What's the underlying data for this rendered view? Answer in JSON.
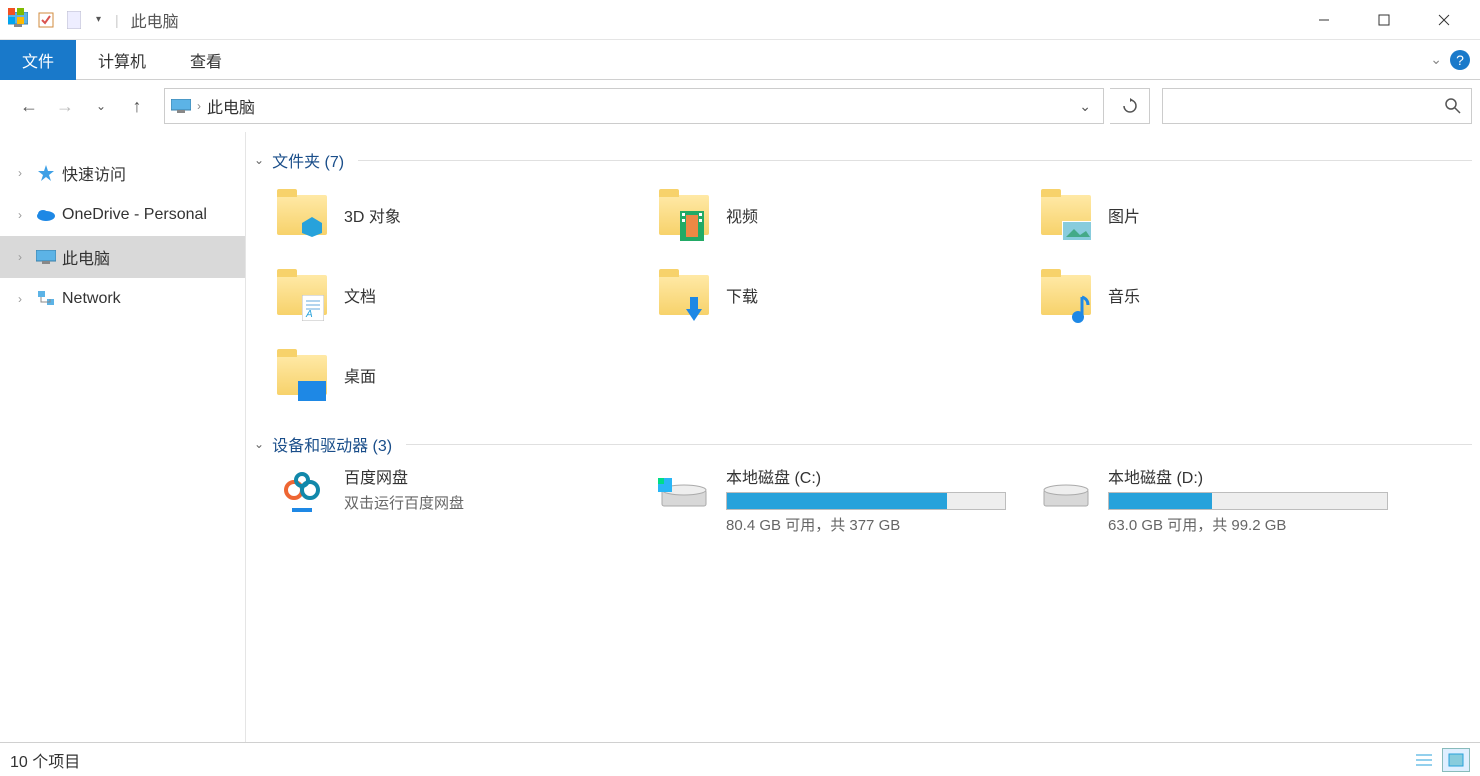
{
  "titlebar": {
    "title": "此电脑"
  },
  "ribbon": {
    "tabs": {
      "file": "文件",
      "computer": "计算机",
      "view": "查看"
    }
  },
  "nav": {
    "breadcrumb": "此电脑",
    "search_placeholder": ""
  },
  "sidebar": {
    "items": [
      {
        "label": "快速访问"
      },
      {
        "label": "OneDrive - Personal"
      },
      {
        "label": "此电脑"
      },
      {
        "label": "Network"
      }
    ]
  },
  "groups": {
    "folders": {
      "label": "文件夹 (7)"
    },
    "devices": {
      "label": "设备和驱动器 (3)"
    }
  },
  "folders": [
    {
      "label": "3D 对象"
    },
    {
      "label": "视频"
    },
    {
      "label": "图片"
    },
    {
      "label": "文档"
    },
    {
      "label": "下载"
    },
    {
      "label": "音乐"
    },
    {
      "label": "桌面"
    }
  ],
  "drives": [
    {
      "name": "百度网盘",
      "sub": "双击运行百度网盘",
      "bar": false
    },
    {
      "name": "本地磁盘 (C:)",
      "stat": "80.4 GB 可用，共 377 GB",
      "fill": 79,
      "bar": true
    },
    {
      "name": "本地磁盘 (D:)",
      "stat": "63.0 GB 可用，共 99.2 GB",
      "fill": 37,
      "bar": true
    }
  ],
  "statusbar": {
    "count": "10 个项目"
  }
}
